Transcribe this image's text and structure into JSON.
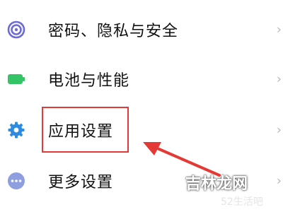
{
  "settings_list": {
    "items": [
      {
        "label": "密码、隐私与安全",
        "icon": "fingerprint-icon",
        "icon_color": "#6b6bd8"
      },
      {
        "label": "电池与性能",
        "icon": "battery-icon",
        "icon_color": "#34c466"
      },
      {
        "label": "应用设置",
        "icon": "gear-icon",
        "icon_color": "#2f8be0"
      },
      {
        "label": "更多设置",
        "icon": "more-dots-icon",
        "icon_color": "#8e9ee0"
      }
    ],
    "chevron": "›"
  },
  "annotation": {
    "highlight_color": "#e53935"
  },
  "watermark": {
    "main": "吉林龙网",
    "sub": "52生活吧"
  }
}
